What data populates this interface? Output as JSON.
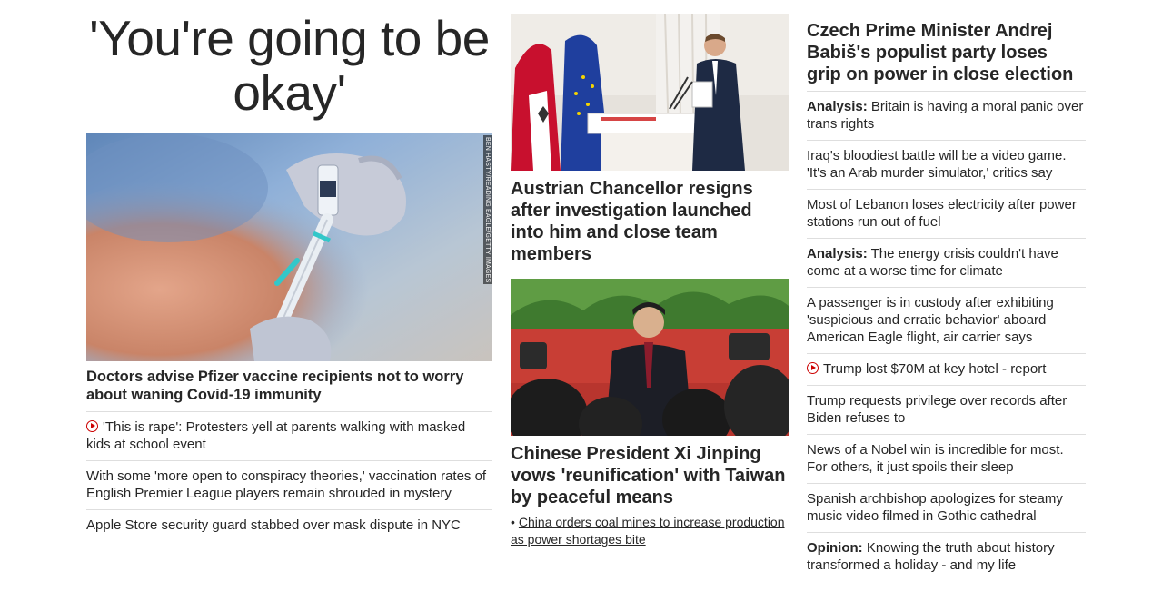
{
  "hero": {
    "title": "'You're going to be okay'",
    "image_credit": "BEN HASTY/READING EAGLE/GETTY IMAGES",
    "headline": "Doctors advise Pfizer vaccine recipients not to worry about waning Covid-19 immunity",
    "related": [
      {
        "text": "'This is rape': Protesters yell at parents walking with masked kids at school event",
        "video": true
      },
      {
        "text": "With some 'more open to conspiracy theories,' vaccination rates of English Premier League players remain shrouded in mystery",
        "video": false
      },
      {
        "text": "Apple Store security guard stabbed over mask dispute in NYC",
        "video": false
      }
    ]
  },
  "middle": {
    "card1_headline": "Austrian Chancellor resigns after investigation launched into him and close team members",
    "card2_headline": "Chinese President Xi Jinping vows 'reunification' with Taiwan by peaceful means",
    "card2_bullet": "•",
    "card2_sublink": "China orders coal mines to increase production as power shortages bite"
  },
  "right": {
    "headline": "Czech Prime Minister Andrej Babiš's populist party loses grip on power in close election",
    "items": [
      {
        "kicker": "Analysis:",
        "text": " Britain is having a moral panic over trans rights"
      },
      {
        "kicker": "",
        "text": "Iraq's bloodiest battle will be a video game. 'It's an Arab murder simulator,' critics say"
      },
      {
        "kicker": "",
        "text": "Most of Lebanon loses electricity after power stations run out of fuel"
      },
      {
        "kicker": "Analysis:",
        "text": " The energy crisis couldn't have come at a worse time for climate"
      },
      {
        "kicker": "",
        "text": "A passenger is in custody after exhibiting 'suspicious and erratic behavior' aboard American Eagle flight, air carrier says"
      },
      {
        "kicker": "",
        "text": "Trump lost $70M at key hotel - report",
        "video": true
      },
      {
        "kicker": "",
        "text": "Trump requests privilege over records after Biden refuses to"
      },
      {
        "kicker": "",
        "text": "News of a Nobel win is incredible for most. For others, it just spoils their sleep"
      },
      {
        "kicker": "",
        "text": "Spanish archbishop apologizes for steamy music video filmed in Gothic cathedral"
      },
      {
        "kicker": "Opinion:",
        "text": " Knowing the truth about history transformed a holiday - and my life"
      }
    ]
  },
  "colors": {
    "text": "#262626",
    "video_icon": "#cc0000",
    "divider": "#dedede"
  }
}
